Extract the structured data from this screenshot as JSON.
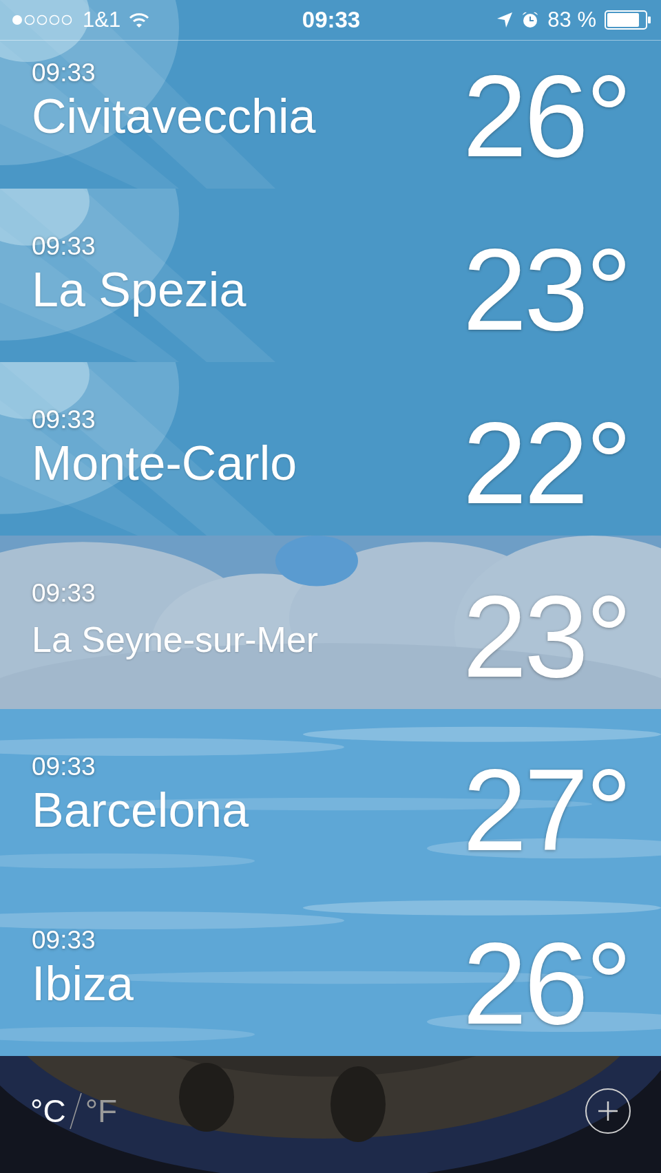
{
  "status_bar": {
    "carrier": "1&1",
    "time": "09:33",
    "battery": "83 %"
  },
  "cities": [
    {
      "time": "09:33",
      "name": "Civitavecchia",
      "temperature": "26°"
    },
    {
      "time": "09:33",
      "name": "La Spezia",
      "temperature": "23°"
    },
    {
      "time": "09:33",
      "name": "Monte-Carlo",
      "temperature": "22°"
    },
    {
      "time": "09:33",
      "name": "La Seyne-sur-Mer",
      "temperature": "23°"
    },
    {
      "time": "09:33",
      "name": "Barcelona",
      "temperature": "27°"
    },
    {
      "time": "09:33",
      "name": "Ibiza",
      "temperature": "26°"
    }
  ],
  "units": [
    {
      "label": "°C",
      "selected": true
    },
    {
      "label": "°F",
      "selected": false
    }
  ]
}
